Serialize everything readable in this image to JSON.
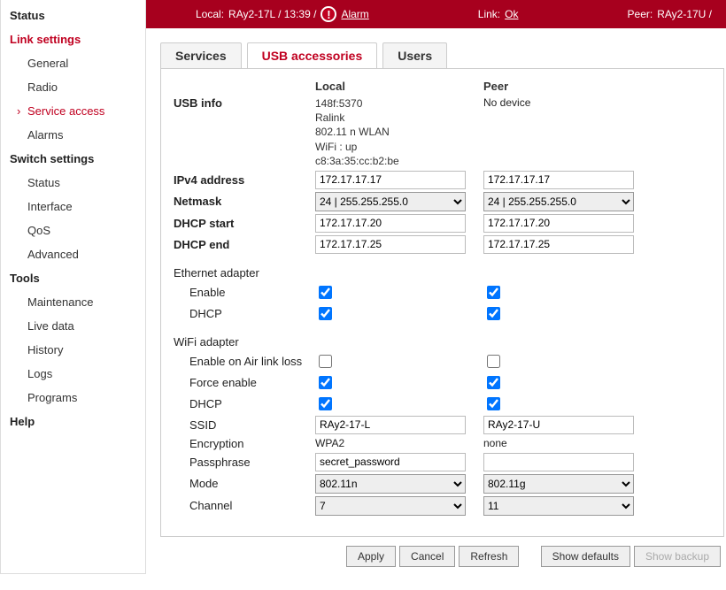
{
  "topbar": {
    "local_label": "Local:",
    "local_value": "RAy2-17L / 13:39 /",
    "alarm": "Alarm",
    "link_label": "Link:",
    "link_value": "Ok",
    "peer_label": "Peer:",
    "peer_value": "RAy2-17U /"
  },
  "sidebar": {
    "status": "Status",
    "link_settings": "Link settings",
    "general": "General",
    "radio": "Radio",
    "service_access": "Service access",
    "alarms": "Alarms",
    "switch_settings": "Switch settings",
    "sw_status": "Status",
    "interface": "Interface",
    "qos": "QoS",
    "advanced": "Advanced",
    "tools": "Tools",
    "maintenance": "Maintenance",
    "live_data": "Live data",
    "history": "History",
    "logs": "Logs",
    "programs": "Programs",
    "help": "Help"
  },
  "tabs": {
    "services": "Services",
    "usb": "USB accessories",
    "users": "Users"
  },
  "headers": {
    "local": "Local",
    "peer": "Peer"
  },
  "form": {
    "usb_info_label": "USB info",
    "usb_info_local": "148f:5370\nRalink\n802.11 n WLAN\nWiFi : up\nc8:3a:35:cc:b2:be",
    "usb_info_peer": "No device",
    "ipv4_label": "IPv4 address",
    "ipv4_local": "172.17.17.17",
    "ipv4_peer": "172.17.17.17",
    "netmask_label": "Netmask",
    "netmask_value": " 24  |  255.255.255.0",
    "dhcp_start_label": "DHCP start",
    "dhcp_start_local": "172.17.17.20",
    "dhcp_start_peer": "172.17.17.20",
    "dhcp_end_label": "DHCP end",
    "dhcp_end_local": "172.17.17.25",
    "dhcp_end_peer": "172.17.17.25",
    "eth_section": "Ethernet adapter",
    "enable_label": "Enable",
    "dhcp_label": "DHCP",
    "wifi_section": "WiFi adapter",
    "enable_air_label": "Enable on Air link loss",
    "force_enable_label": "Force enable",
    "ssid_label": "SSID",
    "ssid_local": "RAy2-17-L",
    "ssid_peer": "RAy2-17-U",
    "encryption_label": "Encryption",
    "encryption_local": "WPA2",
    "encryption_peer": "none",
    "passphrase_label": "Passphrase",
    "passphrase_local": "secret_password",
    "passphrase_peer": "",
    "mode_label": "Mode",
    "mode_local": "802.11n",
    "mode_peer": "802.11g",
    "channel_label": "Channel",
    "channel_local": "7",
    "channel_peer": "11"
  },
  "buttons": {
    "apply": "Apply",
    "cancel": "Cancel",
    "refresh": "Refresh",
    "show_defaults": "Show defaults",
    "show_backup": "Show backup"
  }
}
